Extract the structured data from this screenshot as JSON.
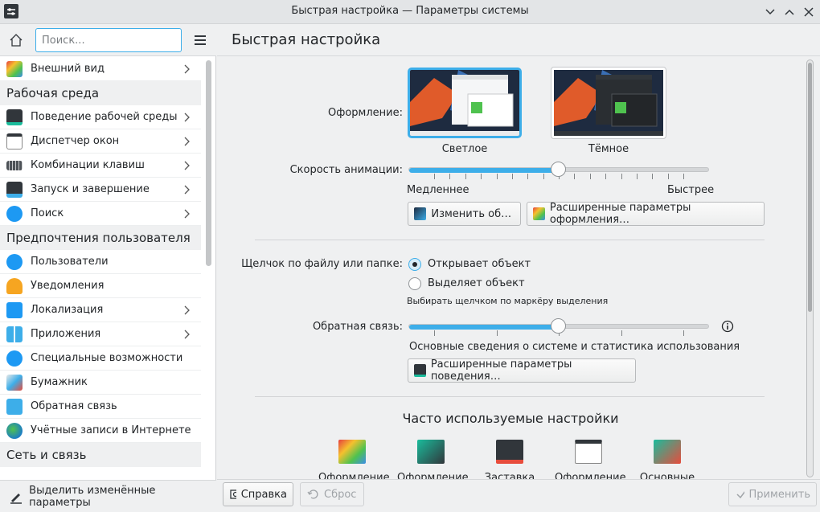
{
  "window": {
    "title": "Быстрая настройка — Параметры системы"
  },
  "sidebar": {
    "search_placeholder": "Поиск...",
    "items": [
      {
        "label": "Внешний вид",
        "kind": "item",
        "chevron": true,
        "icon": "appearance-icon"
      },
      {
        "label": "Рабочая среда",
        "kind": "category"
      },
      {
        "label": "Поведение рабочей среды",
        "kind": "item",
        "chevron": true,
        "icon": "workspace-behavior-icon"
      },
      {
        "label": "Диспетчер окон",
        "kind": "item",
        "chevron": true,
        "icon": "window-manager-icon"
      },
      {
        "label": "Комбинации клавиш",
        "kind": "item",
        "chevron": true,
        "icon": "keyboard-icon"
      },
      {
        "label": "Запуск и завершение",
        "kind": "item",
        "chevron": true,
        "icon": "startup-icon"
      },
      {
        "label": "Поиск",
        "kind": "item",
        "chevron": true,
        "icon": "search-icon"
      },
      {
        "label": "Предпочтения пользователя",
        "kind": "category"
      },
      {
        "label": "Пользователи",
        "kind": "item",
        "chevron": false,
        "icon": "users-icon"
      },
      {
        "label": "Уведомления",
        "kind": "item",
        "chevron": false,
        "icon": "bell-icon"
      },
      {
        "label": "Локализация",
        "kind": "item",
        "chevron": true,
        "icon": "localization-icon"
      },
      {
        "label": "Приложения",
        "kind": "item",
        "chevron": true,
        "icon": "applications-icon"
      },
      {
        "label": "Специальные возможности",
        "kind": "item",
        "chevron": false,
        "icon": "accessibility-icon"
      },
      {
        "label": "Бумажник",
        "kind": "item",
        "chevron": false,
        "icon": "wallet-icon"
      },
      {
        "label": "Обратная связь",
        "kind": "item",
        "chevron": false,
        "icon": "feedback-icon"
      },
      {
        "label": "Учётные записи в Интернете",
        "kind": "item",
        "chevron": false,
        "icon": "globe-icon"
      },
      {
        "label": "Сеть и связь",
        "kind": "category"
      }
    ],
    "highlight_label": "Выделить изменённые параметры"
  },
  "main": {
    "title": "Быстрая настройка",
    "theme_label": "Оформление:",
    "theme_light": "Светлое",
    "theme_dark": "Тёмное",
    "anim_label": "Скорость анимации:",
    "anim_slow": "Медленнее",
    "anim_fast": "Быстрее",
    "anim_level": 0.5,
    "change_wallpaper": "Изменить обои…",
    "advanced_appearance": "Расширенные параметры оформления…",
    "click_label": "Щелчок по файлу или папке:",
    "click_open": "Открывает объект",
    "click_select": "Выделяет объект",
    "click_hint": "Выбирать щелчком по маркёру выделения",
    "feedback_label": "Обратная связь:",
    "feedback_level": 0.5,
    "feedback_desc": "Основные сведения о системе и статистика использования",
    "advanced_behavior": "Расширенные параметры поведения…",
    "frequent_title": "Часто используемые настройки",
    "frequent": [
      "Оформление",
      "Оформление",
      "Заставка",
      "Оформление",
      "Основные"
    ]
  },
  "footer": {
    "help": "Справка",
    "reset": "Сброс",
    "apply": "Применить"
  },
  "colors": {
    "accent": "#3daee9",
    "bg": "#eff0f1"
  }
}
